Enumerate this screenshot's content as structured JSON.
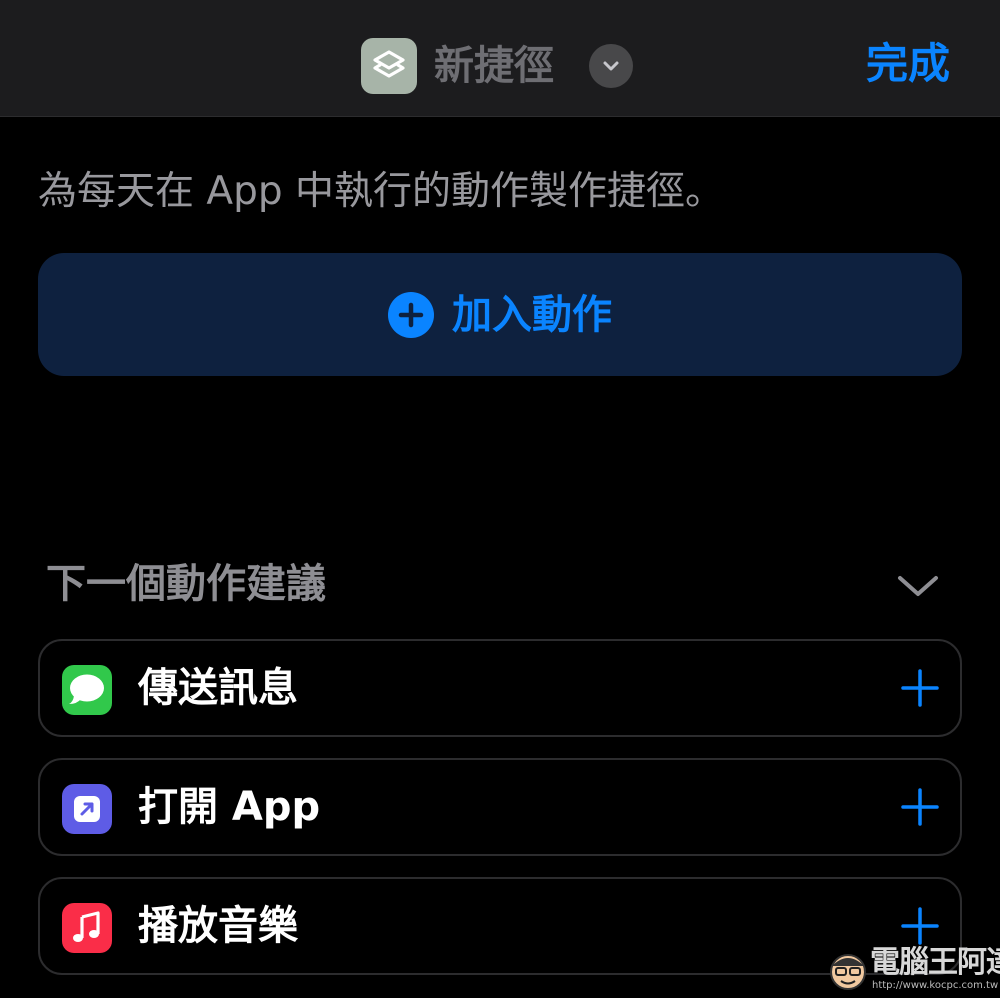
{
  "header": {
    "title": "新捷徑",
    "app_icon": "shortcuts-icon",
    "done_label": "完成"
  },
  "description": "為每天在 App 中執行的動作製作捷徑。",
  "add_action": {
    "label": "加入動作",
    "icon": "plus-circle-icon"
  },
  "suggestions": {
    "title": "下一個動作建議",
    "items": [
      {
        "label": "傳送訊息",
        "icon": "messages-icon"
      },
      {
        "label": "打開 App",
        "icon": "open-app-icon"
      },
      {
        "label": "播放音樂",
        "icon": "music-icon"
      }
    ]
  },
  "watermark": {
    "text": "電腦王阿達",
    "url": "http://www.kocpc.com.tw"
  },
  "colors": {
    "accent": "#0a84ff",
    "background": "#000000",
    "header_bg": "#1c1c1e",
    "add_action_bg": "#0e213f"
  }
}
